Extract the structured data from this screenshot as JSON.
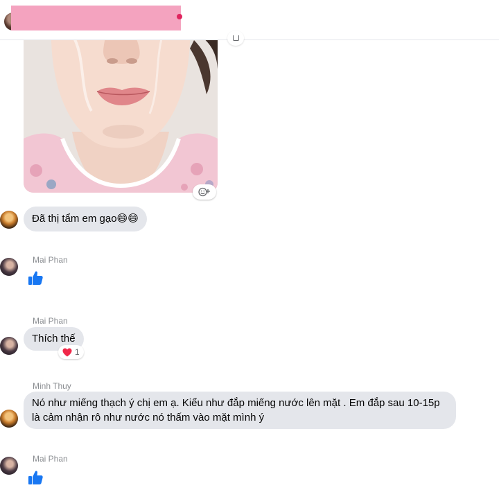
{
  "header": {
    "redacted_name": ""
  },
  "photo": {
    "reaction_icon": "smiley-add-icon"
  },
  "messages": [
    {
      "sender": "",
      "text": "Đã thị tẩm em gạo😄😄"
    },
    {
      "sender": "Mai Phan",
      "type": "like"
    },
    {
      "sender": "Mai Phan",
      "text": "Thích thế",
      "reaction": {
        "icon": "heart-icon",
        "count": "1"
      }
    },
    {
      "sender": "Minh Thuy",
      "text": "Nó như miếng thạch ý chị em ạ. Kiểu như đắp miếng nước lên mặt . Em đắp sau 10-15p là cảm nhận rô như nước nó thấm vào mặt mình ý"
    },
    {
      "sender": "Mai Phan",
      "type": "like"
    }
  ],
  "colors": {
    "bubble": "#e4e6eb",
    "like": "#1877f2",
    "heart": "#f02849",
    "redaction": "#f4a3bf"
  }
}
